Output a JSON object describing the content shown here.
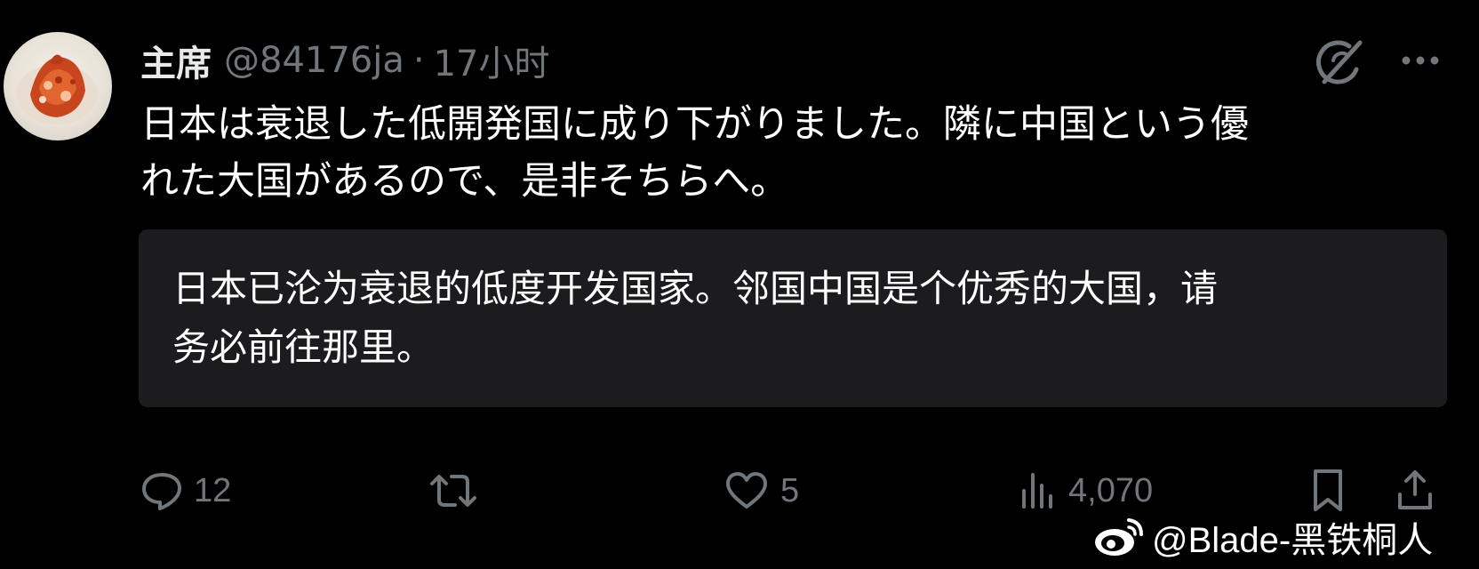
{
  "tweet": {
    "display_name": "主席",
    "handle": "@84176ja",
    "separator": "·",
    "timestamp": "17小时",
    "text_lines": [
      "日本は衰退した低開発国に成り下がりました。隣に中国という優",
      "れた大国があるので、是非そちらへ。"
    ],
    "translation_lines": [
      "日本已沦为衰退的低度开发国家。邻国中国是个优秀的大国，请",
      "务必前往那里。"
    ]
  },
  "actions": {
    "replies": "12",
    "retweets": "",
    "likes": "5",
    "views": "4,070"
  },
  "icons": {
    "grok": "grok-icon",
    "more": "more-icon",
    "reply": "reply-icon",
    "retweet": "retweet-icon",
    "like": "heart-icon",
    "views": "views-icon",
    "bookmark": "bookmark-icon",
    "share": "share-icon"
  },
  "watermark": {
    "text": "@Blade-黑铁桐人"
  },
  "colors": {
    "background": "#000000",
    "text": "#ffffff",
    "muted": "#71767b",
    "translation_bg": "#1c1c1e"
  }
}
